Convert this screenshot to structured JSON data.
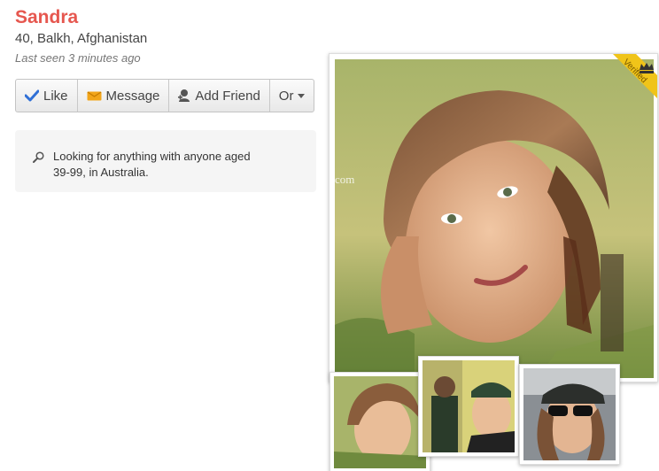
{
  "profile": {
    "name": "Sandra",
    "location": "40, Balkh, Afghanistan",
    "last_seen": "Last seen 3 minutes ago"
  },
  "actions": {
    "like": "Like",
    "message": "Message",
    "add_friend": "Add Friend",
    "or": "Or"
  },
  "looking_for": "Looking for anything with anyone aged 39-99, in Australia.",
  "photo": {
    "badge": "Verified",
    "watermark": "com"
  },
  "icons": {
    "like": "checkmark-icon",
    "message": "envelope-icon",
    "add_friend": "person-add-icon",
    "or": "caret-down-icon",
    "search": "magnifier-icon",
    "badge": "crown-icon"
  },
  "colors": {
    "name": "#e6574f",
    "badge": "#f0c419",
    "like_check": "#2f6fd6",
    "message_env": "#f2a51a"
  }
}
